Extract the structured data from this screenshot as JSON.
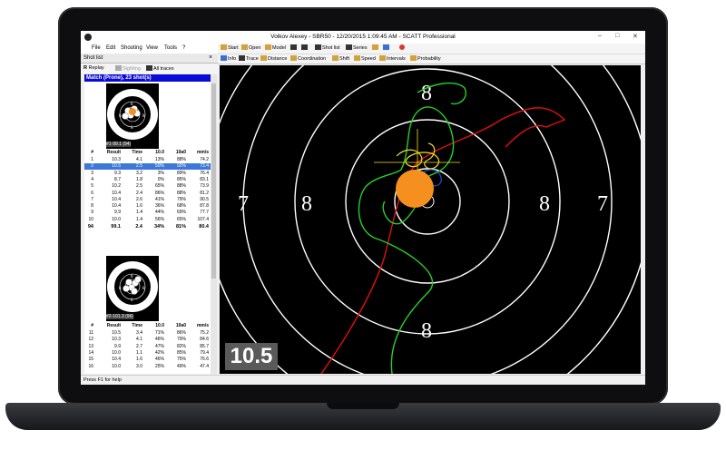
{
  "window": {
    "title": "Volkov Alexey - SBR50 - 12/20/2015 1:09:45 AM - SCATT Professional",
    "controls": [
      "–",
      "□",
      "✕"
    ]
  },
  "menu": [
    "File",
    "Edit",
    "Shooting",
    "View",
    "Tools",
    "?"
  ],
  "toolbar": [
    "Start",
    "Open",
    "Model",
    "Shot list",
    "Series"
  ],
  "toolbar2": [
    "Info",
    "Trace",
    "Distance",
    "Coordination",
    "Shift",
    "Speed",
    "Intervals",
    "Probability"
  ],
  "panel": {
    "title": "Shot list",
    "close": "×",
    "tools": [
      "Replay",
      "Sighting",
      "All traces"
    ],
    "match": "Match (Prone), 23 shot(s)"
  },
  "series": [
    {
      "caption": "#1-99.1 (94)",
      "headers": [
        "#",
        "Result",
        "Time",
        "10.0",
        "10a0",
        "mm/s"
      ],
      "rows": [
        [
          "1",
          "10.3",
          "4.1",
          "13%",
          "88%",
          "74.2"
        ],
        [
          "2",
          "10.5",
          "2.5",
          "50%",
          "92%",
          "73.4"
        ],
        [
          "3",
          "9.3",
          "3.2",
          "3%",
          "89%",
          "76.4"
        ],
        [
          "4",
          "8.7",
          "1.8",
          "0%",
          "85%",
          "83.1"
        ],
        [
          "5",
          "10.2",
          "2.5",
          "65%",
          "88%",
          "73.9"
        ],
        [
          "6",
          "10.4",
          "2.4",
          "86%",
          "88%",
          "81.2"
        ],
        [
          "7",
          "10.4",
          "2.6",
          "41%",
          "79%",
          "90.5"
        ],
        [
          "8",
          "10.4",
          "1.6",
          "36%",
          "68%",
          "87.8"
        ],
        [
          "9",
          "9.9",
          "1.4",
          "44%",
          "69%",
          "77.7"
        ],
        [
          "10",
          "10.0",
          "1.4",
          "56%",
          "65%",
          "107.4"
        ]
      ],
      "total": [
        "94",
        "99.1",
        "2.4",
        "34%",
        "81%",
        "80.4"
      ]
    },
    {
      "caption": "#2-101.3 (96)",
      "headers": [
        "#",
        "Result",
        "Time",
        "10.0",
        "10a0",
        "mm/s"
      ],
      "rows": [
        [
          "11",
          "10.5",
          "3.4",
          "71%",
          "86%",
          "75.2"
        ],
        [
          "12",
          "10.3",
          "4.1",
          "46%",
          "79%",
          "84.6"
        ],
        [
          "13",
          "9.9",
          "2.7",
          "47%",
          "82%",
          "85.7"
        ],
        [
          "14",
          "10.0",
          "1.1",
          "42%",
          "85%",
          "79.4"
        ],
        [
          "15",
          "10.4",
          "1.6",
          "46%",
          "75%",
          "76.6"
        ],
        [
          "16",
          "10.0",
          "3.0",
          "25%",
          "49%",
          "47.4"
        ]
      ]
    }
  ],
  "target": {
    "ring_labels": [
      "7",
      "8",
      "8",
      "7",
      "8",
      "8"
    ]
  },
  "score": "10.5",
  "status": "Press F1 for help"
}
